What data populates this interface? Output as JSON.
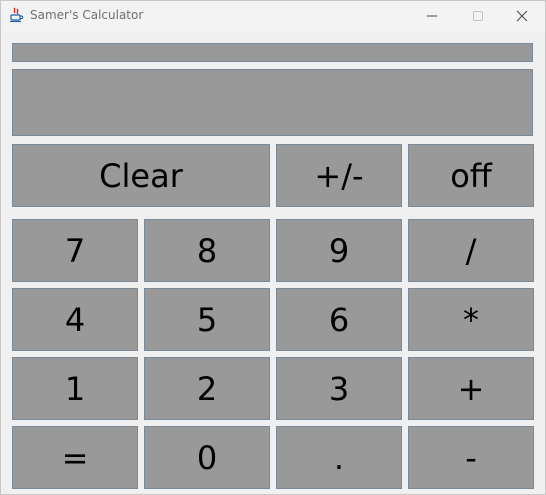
{
  "window": {
    "title": "Samer's Calculator",
    "icon": "java-icon",
    "controls": {
      "minimize": "minimize-icon",
      "maximize": "maximize-icon",
      "close": "close-icon"
    }
  },
  "operation_field": {
    "value": ""
  },
  "display": {
    "value": ""
  },
  "keys": {
    "clear": "Clear",
    "negate": "+/-",
    "off": "off",
    "seven": "7",
    "eight": "8",
    "nine": "9",
    "divide": "/",
    "four": "4",
    "five": "5",
    "six": "6",
    "multiply": "*",
    "one": "1",
    "two": "2",
    "three": "3",
    "plus": "+",
    "equals": "=",
    "zero": "0",
    "decimal": ".",
    "minus": "-"
  },
  "colors": {
    "key_background": "#999999",
    "key_border": "#7a8a9a",
    "window_background": "#f0f0f0"
  }
}
